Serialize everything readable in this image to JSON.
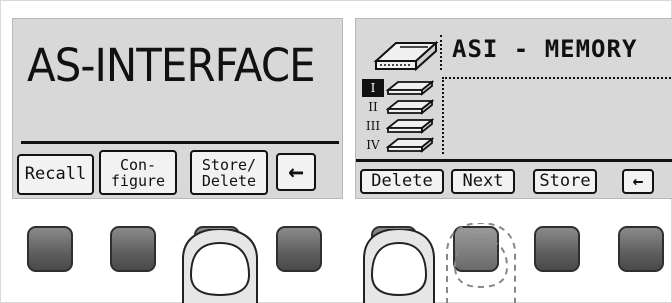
{
  "left_screen": {
    "title": "AS-INTERFACE",
    "softkeys": [
      {
        "line1": "Recall",
        "line2": ""
      },
      {
        "line1": "Con-",
        "line2": "figure"
      },
      {
        "line1": "Store/",
        "line2": "Delete"
      },
      {
        "line1": "←",
        "line2": ""
      }
    ]
  },
  "right_screen": {
    "title": "ASI - MEMORY",
    "slots": [
      {
        "label": "I",
        "active": true
      },
      {
        "label": "II",
        "active": false
      },
      {
        "label": "III",
        "active": false
      },
      {
        "label": "IV",
        "active": false
      }
    ],
    "softkeys": [
      "Delete",
      "Next",
      "Store",
      "←"
    ]
  },
  "icons": {
    "memory": "memory-card-icon",
    "back": "back-arrow-icon",
    "finger": "finger-press-icon"
  },
  "colors": {
    "lcd_background": "#d8d8d8",
    "ink": "#111111",
    "device_key": "#6b6b6b"
  }
}
